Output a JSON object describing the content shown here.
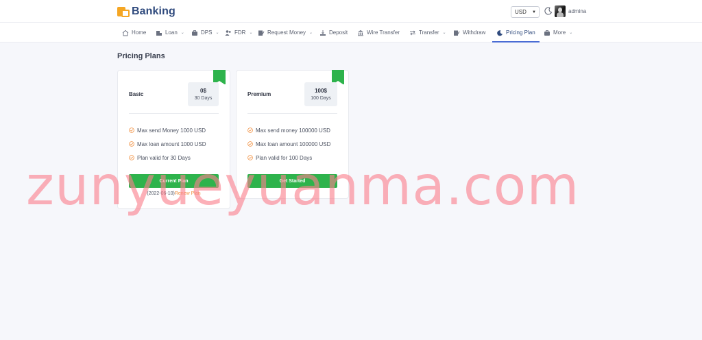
{
  "brand": {
    "name": "Banking",
    "accent": "#f5a623",
    "color": "#2f4a7d"
  },
  "header": {
    "currency": "USD",
    "username": "admina"
  },
  "nav": [
    {
      "label": "Home",
      "icon": "home-icon",
      "has_dropdown": false
    },
    {
      "label": "Loan",
      "icon": "building-icon",
      "has_dropdown": true
    },
    {
      "label": "DPS",
      "icon": "briefcase-icon",
      "has_dropdown": true
    },
    {
      "label": "FDR",
      "icon": "users-icon",
      "has_dropdown": true
    },
    {
      "label": "Request Money",
      "icon": "edit-icon",
      "has_dropdown": true
    },
    {
      "label": "Deposit",
      "icon": "deposit-icon",
      "has_dropdown": false
    },
    {
      "label": "Wire Transfer",
      "icon": "bank-icon",
      "has_dropdown": false
    },
    {
      "label": "Transfer",
      "icon": "exchange-icon",
      "has_dropdown": true
    },
    {
      "label": "Withdraw",
      "icon": "edit-icon",
      "has_dropdown": false
    },
    {
      "label": "Pricing Plan",
      "icon": "moon-icon",
      "has_dropdown": false,
      "active": true
    },
    {
      "label": "More",
      "icon": "briefcase-icon",
      "has_dropdown": true
    }
  ],
  "page": {
    "title": "Pricing Plans"
  },
  "plans": [
    {
      "name": "Basic",
      "price": "0$",
      "duration": "30 Days",
      "features": [
        "Max send Money 1000 USD",
        "Max loan amount 1000 USD",
        "Plan valid for 30 Days"
      ],
      "button": "Current Plan",
      "renew_date": "(2022-06-10)",
      "renew_link": "Renew Plan"
    },
    {
      "name": "Premium",
      "price": "100$",
      "duration": "100 Days",
      "features": [
        "Max send money 100000 USD",
        "Max loan amount 100000 USD",
        "Plan valid for 100 Days"
      ],
      "button": "Get Started"
    }
  ],
  "watermark": "zunyueyuanma.com",
  "colors": {
    "green": "#2eb34c",
    "check": "#f08c3a",
    "active_underline": "#4a6cd4",
    "renew_link": "#f08c3a"
  }
}
